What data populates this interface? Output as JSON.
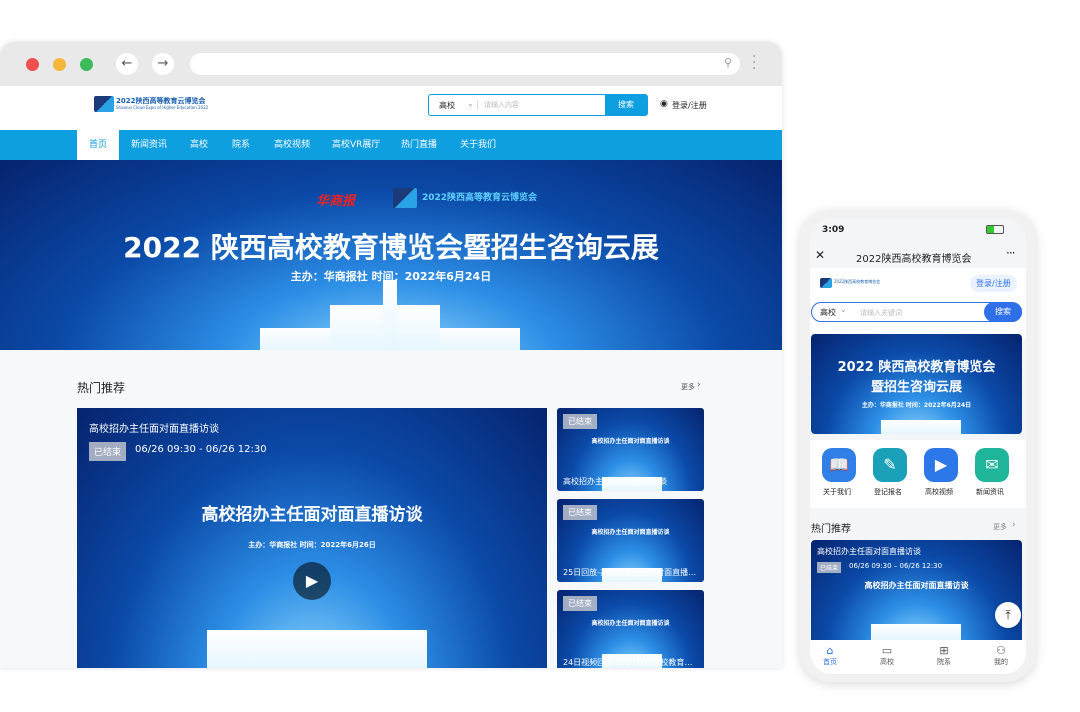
{
  "desktop": {
    "logo_text": "2022陕西高等教育云博览会",
    "logo_sub": "Shaanxi Cloud Expo of Higher Education 2022",
    "search": {
      "category": "高校",
      "placeholder": "请输入内容",
      "button": "搜索"
    },
    "login": "登录/注册",
    "nav": [
      "首页",
      "新闻资讯",
      "高校",
      "院系",
      "高校视频",
      "高校VR展厅",
      "热门直播",
      "关于我们"
    ],
    "banner": {
      "partner": "华商报",
      "title": "2022 陕西高校教育博览会暨招生咨询云展",
      "subtitle": "主办：华商报社  时间：2022年6月24日"
    },
    "section_title": "热门推荐",
    "more": "更多",
    "featured": {
      "title": "高校招办主任面对面直播访谈",
      "status": "已结束",
      "time": "06/26 09:30 - 06/26 12:30",
      "poster_title": "高校招办主任面对面直播访谈",
      "poster_sub": "主办：华商报社  时间：2022年6月26日"
    },
    "cards": [
      {
        "status": "已结束",
        "caption": "高校招办主任面对面直播访谈",
        "poster_title": "高校招办主任面对面直播访谈"
      },
      {
        "status": "已结束",
        "caption": "25日回放-高校招办主任面对面直播访谈",
        "poster_title": "高校招办主任面对面直播访谈"
      },
      {
        "status": "已结束",
        "caption": "24日视频回放-2022陕西高校教育博览...",
        "poster_title": "高校招办主任面对面直播访谈"
      }
    ]
  },
  "mobile": {
    "time": "3:09",
    "title": "2022陕西高校教育博览会",
    "login": "登录/注册",
    "search": {
      "category": "高校",
      "placeholder": "请输入关键词",
      "button": "搜索"
    },
    "banner": {
      "title1": "2022 陕西高校教育博览会",
      "title2": "暨招生咨询云展",
      "subtitle": "主办：华商报社  时间：2022年6月24日"
    },
    "shortcuts": [
      {
        "label": "关于我们",
        "icon": "book-icon",
        "color": "#2f7fe6"
      },
      {
        "label": "登记报名",
        "icon": "register-icon",
        "color": "#1aa0b8"
      },
      {
        "label": "高校视频",
        "icon": "video-icon",
        "color": "#2d78e8"
      },
      {
        "label": "新闻资讯",
        "icon": "mailbox-icon",
        "color": "#1fb59a"
      }
    ],
    "section_title": "热门推荐",
    "more": "更多",
    "featured": {
      "title": "高校招办主任面对面直播访谈",
      "status": "已结束",
      "time": "06/26 09:30 – 06/26 12:30",
      "poster_title": "高校招办主任面对面直播访谈"
    },
    "tabs": [
      "首页",
      "高校",
      "院系",
      "我的"
    ],
    "accent": "#2f6fe8"
  }
}
